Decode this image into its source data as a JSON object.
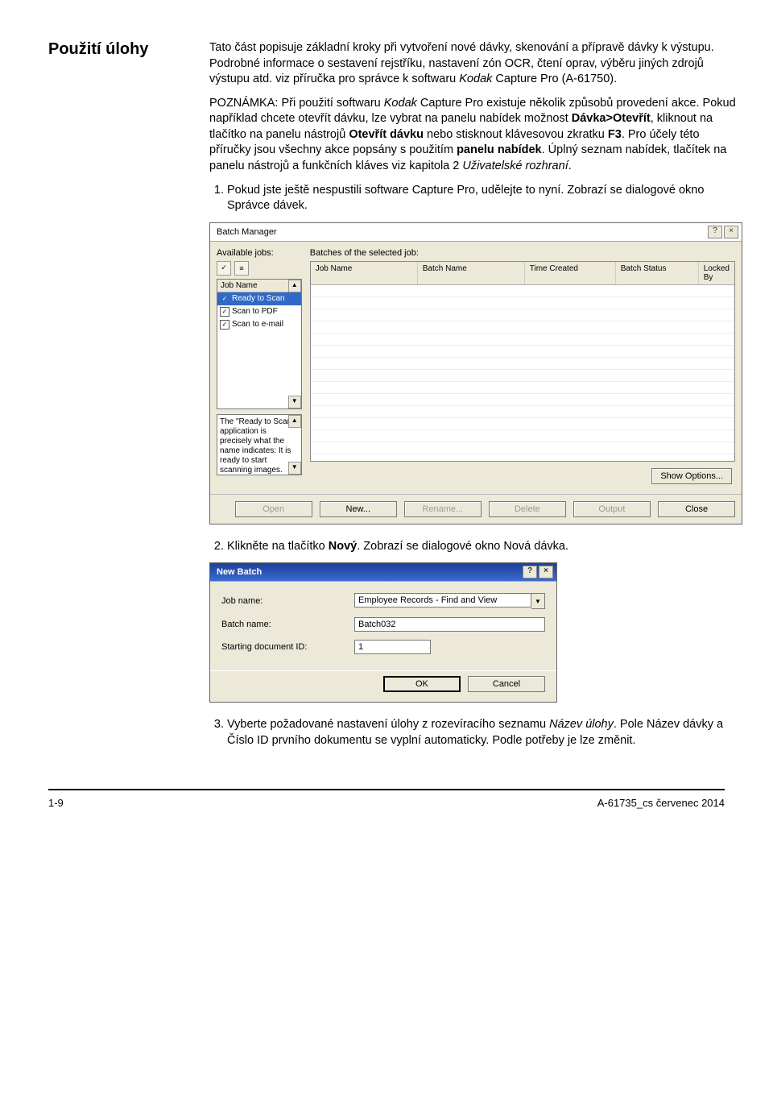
{
  "section_title": "Použití úlohy",
  "intro": {
    "p1a": "Tato část popisuje základní kroky při vytvoření nové dávky, skenování a přípravě dávky k výstupu. Podrobné informace o sestavení rejstříku, nastavení zón OCR, čtení oprav, výběru jiných zdrojů výstupu atd. viz příručka pro správce k softwaru ",
    "p1b_italic": "Kodak",
    "p1c": " Capture Pro (A-61750).",
    "note_label": "POZNÁMKA: ",
    "note_a": "Při použití softwaru ",
    "note_b_italic": "Kodak",
    "note_c": " Capture Pro existuje několik způsobů provedení akce. Pokud například chcete otevřít dávku, lze vybrat na panelu nabídek možnost ",
    "note_d_bold": "Dávka>Otevřít",
    "note_e": ", kliknout na tlačítko na panelu nástrojů ",
    "note_f_bold": "Otevřít dávku",
    "note_g": " nebo stisknout klávesovou zkratku ",
    "note_h_bold": "F3",
    "note_i": ". Pro účely této příručky jsou všechny akce popsány s použitím ",
    "note_j_bold": "panelu nabídek",
    "note_k": ". Úplný seznam nabídek, tlačítek na panelu nástrojů a funkčních kláves viz kapitola 2 ",
    "note_l_italic": "Uživatelské rozhraní",
    "note_m": "."
  },
  "steps": {
    "s1": "Pokud jste ještě nespustili software Capture Pro, udělejte to nyní. Zobrazí se dialogové okno Správce dávek.",
    "s2a": "Klikněte na tlačítko ",
    "s2b_bold": "Nový",
    "s2c": ". Zobrazí se dialogové okno Nová dávka.",
    "s3a": "Vyberte požadované nastavení úlohy z rozevíracího seznamu ",
    "s3b_italic": "Název úlohy",
    "s3c": ". Pole Název dávky a Číslo ID prvního dokumentu se vyplní automaticky. Podle potřeby je lze změnit."
  },
  "batch_manager": {
    "title": "Batch Manager",
    "left_label": "Available jobs:",
    "right_label": "Batches of the selected job:",
    "head_jobname": "Job Name",
    "jobs": [
      "Ready to Scan",
      "Scan to PDF",
      "Scan to e-mail"
    ],
    "desc": "The \"Ready to Scan\" application is precisely what the name indicates: It is ready to start scanning images.",
    "columns": [
      "Job Name",
      "Batch Name",
      "Time Created",
      "Batch Status",
      "Locked By"
    ],
    "show_options": "Show Options...",
    "buttons": {
      "open": "Open",
      "new": "New...",
      "rename": "Rename...",
      "delete": "Delete",
      "output": "Output",
      "close": "Close"
    }
  },
  "new_batch": {
    "title": "New Batch",
    "job_name_label": "Job name:",
    "job_name_value": "Employee Records - Find and View",
    "batch_name_label": "Batch name:",
    "batch_name_value": "Batch032",
    "starting_id_label": "Starting document ID:",
    "starting_id_value": "1",
    "ok": "OK",
    "cancel": "Cancel"
  },
  "footer": {
    "left": "1-9",
    "right": "A-61735_cs  červenec 2014"
  }
}
